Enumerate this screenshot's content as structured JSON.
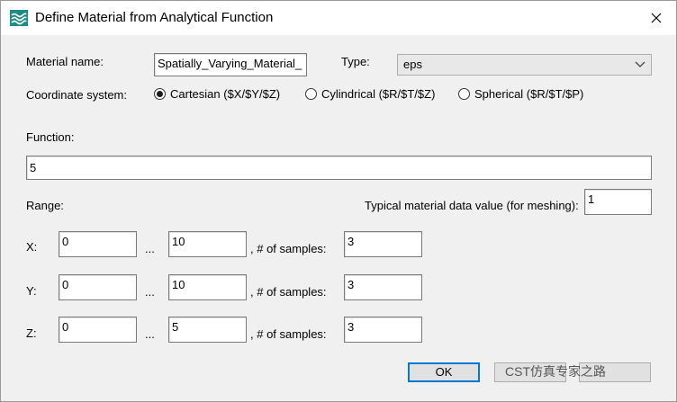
{
  "window": {
    "title": "Define Material from Analytical Function"
  },
  "icons": {
    "app": "wave-material-icon",
    "close": "close-icon",
    "dropdown": "chevron-down-icon"
  },
  "form": {
    "material_name_label": "Material name:",
    "material_name_value": "Spatially_Varying_Material_",
    "type_label": "Type:",
    "type_value": "eps",
    "coord_label": "Coordinate system:",
    "coords": [
      {
        "label": "Cartesian ($X/$Y/$Z)",
        "selected": true
      },
      {
        "label": "Cylindrical ($R/$T/$Z)",
        "selected": false
      },
      {
        "label": "Spherical ($R/$T/$P)",
        "selected": false
      }
    ],
    "function_label": "Function:",
    "function_value": "5",
    "range_label": "Range:",
    "typical_label": "Typical material data value (for meshing):",
    "typical_value": "1",
    "ellipsis": "...",
    "samples_label": ", # of samples:",
    "rows": [
      {
        "axis": "X:",
        "min": "0",
        "max": "10",
        "samples": "3"
      },
      {
        "axis": "Y:",
        "min": "0",
        "max": "10",
        "samples": "3"
      },
      {
        "axis": "Z:",
        "min": "0",
        "max": "5",
        "samples": "3"
      }
    ]
  },
  "buttons": {
    "ok": "OK"
  },
  "watermark": "CST仿真专家之路"
}
